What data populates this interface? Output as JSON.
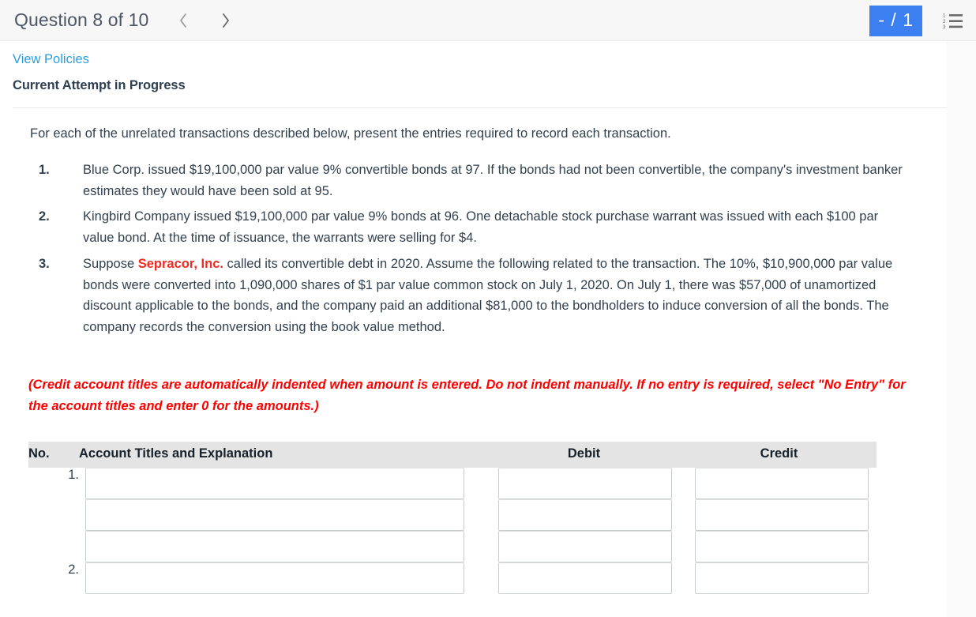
{
  "header": {
    "question_label": "Question 8 of 10",
    "prev_icon": "chevron-left-icon",
    "next_icon": "chevron-right-icon",
    "score_badge": "- / 1",
    "list_icon": "numbered-list-icon",
    "badge_color": "#3b7ff1"
  },
  "toolbar": {
    "view_policies": "View Policies",
    "attempt_status": "Current Attempt in Progress"
  },
  "question": {
    "intro": "For each of the unrelated transactions described below, present the entries required to record each transaction.",
    "items": [
      {
        "number": "1.",
        "text": "Blue Corp. issued $19,100,000 par value 9% convertible bonds at 97. If the bonds had not been convertible, the company's investment banker estimates they would have been sold at 95."
      },
      {
        "number": "2.",
        "text": "Kingbird Company issued $19,100,000 par value 9% bonds at 96. One detachable stock purchase warrant was issued with each $100 par value bond. At the time of issuance, the warrants were selling for $4."
      },
      {
        "number": "3.",
        "prefix": "Suppose ",
        "highlight": "Sepracor, Inc.",
        "highlight_color": "#ef2b23",
        "suffix": " called its convertible debt in 2020. Assume the following related to the transaction. The 10%, $10,900,000 par value bonds were converted into 1,090,000 shares of $1 par value common stock on July 1, 2020. On July 1, there was $57,000 of unamortized discount applicable to the bonds, and the company paid an additional $81,000 to the bondholders to induce conversion of all the bonds. The company records the conversion using the book value method."
      }
    ],
    "credit_note": "(Credit account titles are automatically indented when amount is entered. Do not indent manually. If no entry is required, select \"No Entry\" for the account titles and enter 0 for the amounts.)",
    "credit_note_color": "#ff0000"
  },
  "table": {
    "headers": {
      "no": "No.",
      "account": "Account Titles and Explanation",
      "debit": "Debit",
      "credit": "Credit"
    },
    "rows": [
      {
        "no": "1.",
        "account": "",
        "debit": "",
        "credit": ""
      },
      {
        "no": "",
        "account": "",
        "debit": "",
        "credit": ""
      },
      {
        "no": "",
        "account": "",
        "debit": "",
        "credit": ""
      },
      {
        "no": "2.",
        "account": "",
        "debit": "",
        "credit": ""
      }
    ]
  }
}
